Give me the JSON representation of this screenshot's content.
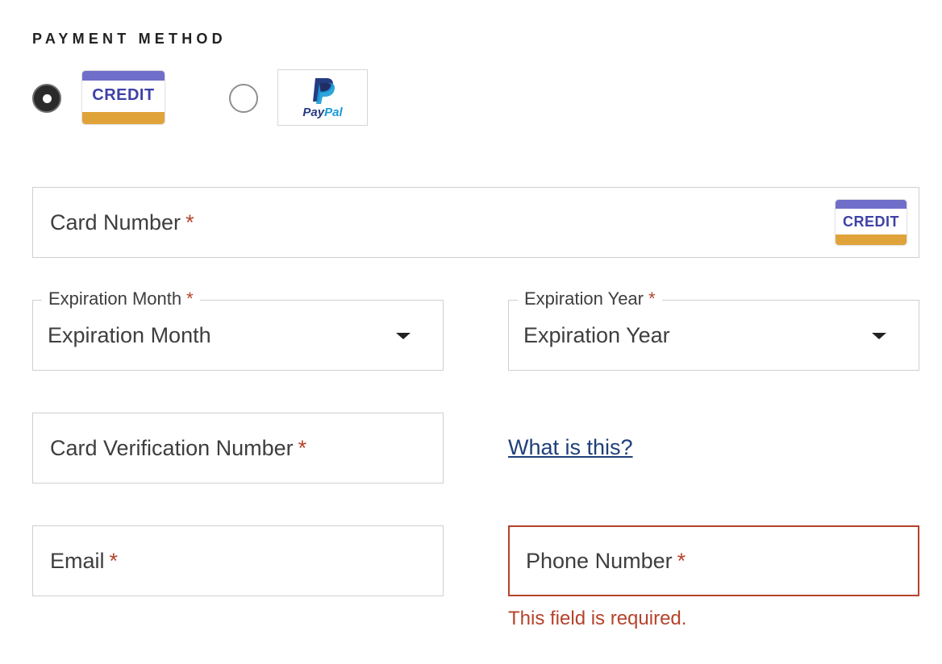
{
  "payment_method": {
    "title": "PAYMENT METHOD",
    "options": [
      {
        "label": "CREDIT",
        "selected": true,
        "icon": "credit-card-icon"
      },
      {
        "label_pay": "Pay",
        "label_pal": "Pal",
        "selected": false,
        "icon": "paypal-icon"
      }
    ]
  },
  "form": {
    "required_marker": "*",
    "card_number": {
      "placeholder": "Card Number",
      "badge": "CREDIT"
    },
    "expiration_month": {
      "label": "Expiration Month",
      "value": "Expiration Month"
    },
    "expiration_year": {
      "label": "Expiration Year",
      "value": "Expiration Year"
    },
    "cvv": {
      "placeholder": "Card Verification Number",
      "help_link": "What is this?"
    },
    "email": {
      "placeholder": "Email"
    },
    "phone": {
      "placeholder": "Phone Number",
      "error": "This field is required."
    }
  },
  "colors": {
    "error": "#b5432b",
    "link": "#1f3f7a",
    "credit_top": "#6f6fc9",
    "credit_bottom": "#dfa33a",
    "credit_text": "#3e41a5",
    "paypal_dark": "#253b80",
    "paypal_light": "#179bd7"
  }
}
